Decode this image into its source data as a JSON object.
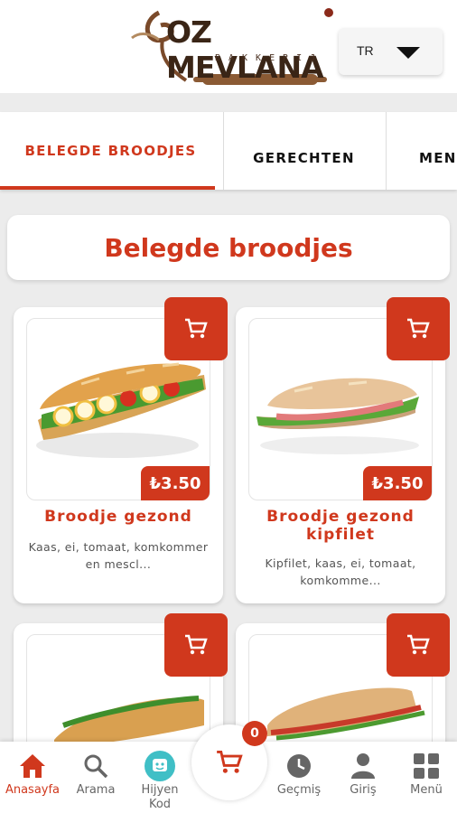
{
  "header": {
    "logo_text": "OZ MEVLANA",
    "logo_subtext": "BAKKERIJ",
    "language": "TR"
  },
  "tabs": [
    {
      "label": "BELEGDE BROODJES",
      "active": true
    },
    {
      "label": "GERECHTEN",
      "active": false
    },
    {
      "label": "MENU",
      "active": false
    }
  ],
  "section": {
    "title": "Belegde broodjes"
  },
  "products": [
    {
      "name": "Broodje gezond",
      "price": "₺3.50",
      "description": "Kaas, ei, tomaat, komkommer en mescl..."
    },
    {
      "name": "Broodje gezond kipfilet",
      "price": "₺3.50",
      "description": "Kipfilet, kaas, ei, tomaat, komkomme..."
    }
  ],
  "bottom_nav": {
    "home": "Anasayfa",
    "search": "Arama",
    "hijyen": "Hijyen Kod",
    "cart_count": "0",
    "history": "Geçmiş",
    "login": "Giriş",
    "menu": "Menü"
  },
  "colors": {
    "accent": "#d0381d",
    "hijyen": "#40bfc6",
    "background": "#ececec"
  }
}
